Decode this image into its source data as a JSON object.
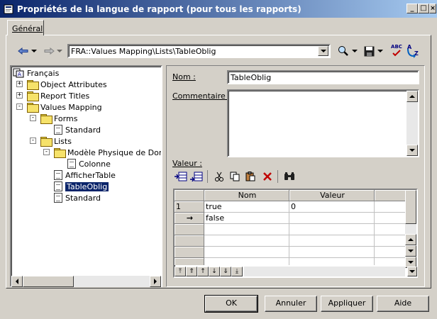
{
  "window": {
    "title": "Propriétés de la langue de rapport (pour tous les rapports)",
    "controls": {
      "minimize": "_",
      "maximize": "□",
      "close": "×"
    }
  },
  "tabs": [
    {
      "label": "Général",
      "selected": true
    }
  ],
  "toolbar": {
    "path": "FRA::Values Mapping\\Lists\\TableOblig",
    "back_icon": "back-arrow-icon",
    "forward_icon": "forward-arrow-icon",
    "find_icon": "find-icon",
    "save_icon": "save-icon",
    "spell_icon": "spell-check-icon",
    "sort_icon": "sort-icon",
    "spell_text": "ABC",
    "sort_text_a": "A",
    "sort_text_z": "Z"
  },
  "tree": {
    "root": "Français",
    "items": [
      {
        "label": "Object Attributes",
        "type": "folder",
        "level": 1,
        "expander": "+"
      },
      {
        "label": "Report Titles",
        "type": "folder",
        "level": 1,
        "expander": "+"
      },
      {
        "label": "Values Mapping",
        "type": "folder",
        "level": 1,
        "expander": "-"
      },
      {
        "label": "Forms",
        "type": "folder",
        "level": 2,
        "expander": "-"
      },
      {
        "label": "Standard",
        "type": "table",
        "level": 3
      },
      {
        "label": "Lists",
        "type": "folder",
        "level": 2,
        "expander": "-"
      },
      {
        "label": "Modèle Physique de Données",
        "type": "folder",
        "level": 3,
        "expander": "-"
      },
      {
        "label": "Colonne",
        "type": "table",
        "level": 4
      },
      {
        "label": "AfficherTable",
        "type": "table",
        "level": 3
      },
      {
        "label": "TableOblig",
        "type": "table",
        "level": 3,
        "selected": true
      },
      {
        "label": "Standard",
        "type": "table",
        "level": 3
      }
    ]
  },
  "form": {
    "name_label": "Nom :",
    "name_value": "TableOblig",
    "comment_label": "Commentaire :",
    "comment_value": "",
    "value_label": "Valeur :"
  },
  "grid": {
    "columns": [
      "Nom",
      "Valeur"
    ],
    "rows": [
      {
        "marker": "1",
        "nom": "true",
        "valeur": "0"
      },
      {
        "marker": "→",
        "nom": "false",
        "valeur": ""
      }
    ]
  },
  "colors": {
    "titlebar_start": "#0a246a",
    "titlebar_end": "#a6caf0",
    "selection": "#0a246a",
    "face": "#d4d0c8"
  },
  "buttons": {
    "ok": "OK",
    "cancel": "Annuler",
    "apply": "Appliquer",
    "help": "Aide"
  }
}
